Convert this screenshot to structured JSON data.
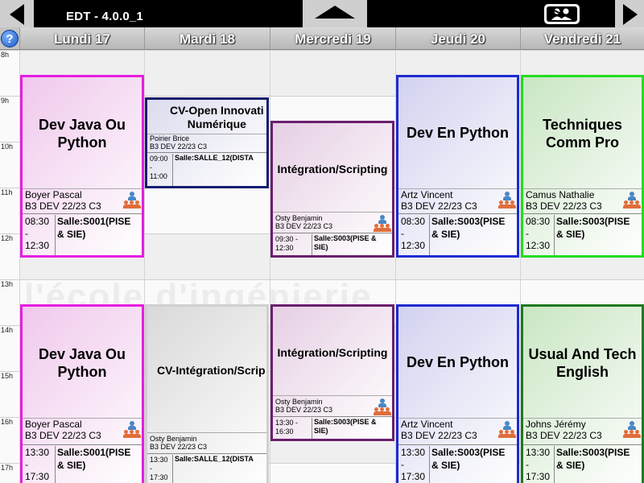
{
  "app": {
    "title": "EDT - 4.0.0_1"
  },
  "toolbar": {
    "prev_icon": "triangle-left-icon",
    "collapse_icon": "triangle-up-icon",
    "group_icon": "group-people-icon",
    "next_icon": "triangle-right-icon"
  },
  "help": {
    "label": "?"
  },
  "days": [
    "Lundi 17",
    "Mardi 18",
    "Mercredi 19",
    "Jeudi 20",
    "Vendredi 21"
  ],
  "hours": [
    "8h",
    "9h",
    "10h",
    "11h",
    "12h",
    "13h",
    "14h",
    "15h",
    "16h",
    "17h"
  ],
  "colors": {
    "pink": "#e61ee0",
    "navy": "#141e6e",
    "purple": "#6a1f6e",
    "blue": "#1e2bd0",
    "green": "#22dd22",
    "darkgreen": "#1f7a1f",
    "gray": "#d0d0d0"
  },
  "events": [
    {
      "title": "Dev Java Ou\nPython",
      "teacher": "Boyer Pascal",
      "group": "B3 DEV 22/23 C3",
      "time": "08:30\n-\n12:30",
      "room": "Salle:S001(PISE\n& SIE)"
    },
    {
      "title": "CV-Open Innovati\nNumérique",
      "teacher": "Poirier Brice",
      "group": "B3 DEV 22/23 C3",
      "time": "09:00\n-\n11:00",
      "room": "Salle:SALLE_12(DISTA"
    },
    {
      "title": "Intégration/Scripting",
      "teacher": "Osty Benjamin",
      "group": "B3 DEV 22/23 C3",
      "time": "09:30 -\n12:30",
      "room": "Salle:S003(PISE &\nSIE)"
    },
    {
      "title": "Dev En Python",
      "teacher": "Artz Vincent",
      "group": "B3 DEV 22/23 C3",
      "time": "08:30\n-\n12:30",
      "room": "Salle:S003(PISE\n& SIE)"
    },
    {
      "title": "Techniques\nComm Pro",
      "teacher": "Camus Nathalie",
      "group": "B3 DEV 22/23 C3",
      "time": "08:30\n-\n12:30",
      "room": "Salle:S003(PISE\n& SIE)"
    },
    {
      "title": "Dev Java Ou\nPython",
      "teacher": "Boyer Pascal",
      "group": "B3 DEV 22/23 C3",
      "time": "13:30\n-\n17:30",
      "room": "Salle:S001(PISE\n& SIE)"
    },
    {
      "title": "CV-Intégration/Scrip",
      "teacher": "Osty Benjamin",
      "group": "B3 DEV 22/23 C3",
      "time": "13:30\n-\n17:30",
      "room": "Salle:SALLE_12(DISTA"
    },
    {
      "title": "Intégration/Scripting",
      "teacher": "Osty Benjamin",
      "group": "B3 DEV 22/23 C3",
      "time": "13:30 -\n16:30",
      "room": "Salle:S003(PISE &\nSIE)"
    },
    {
      "title": "Dev En Python",
      "teacher": "Artz Vincent",
      "group": "B3 DEV 22/23 C3",
      "time": "13:30\n-\n17:30",
      "room": "Salle:S003(PISE\n& SIE)"
    },
    {
      "title": "Usual And Tech\nEnglish",
      "teacher": "Johns Jérémy",
      "group": "B3 DEV 22/23 C3",
      "time": "13:30\n-\n17:30",
      "room": "Salle:S003(PISE\n& SIE)"
    }
  ]
}
